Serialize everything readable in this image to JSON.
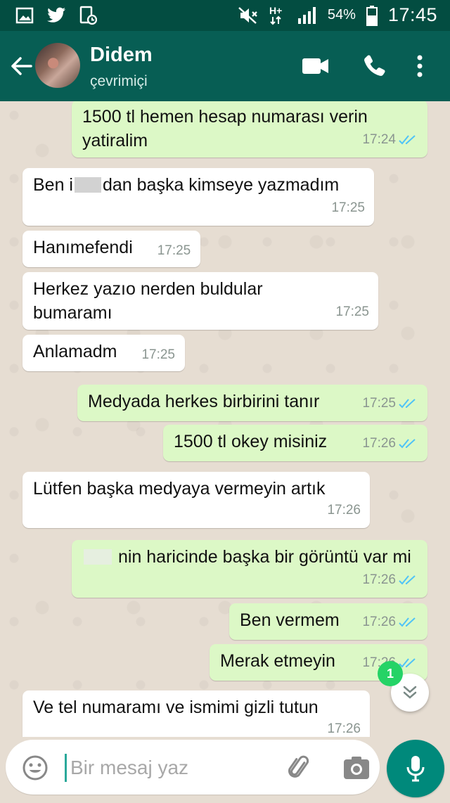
{
  "status_bar": {
    "battery": "54%",
    "clock": "17:45",
    "network": "H+",
    "left_icons": [
      "gallery-icon",
      "twitter-icon",
      "call-log-icon"
    ],
    "right_icons": [
      "mute-icon",
      "network-icon",
      "signal-icon",
      "battery-icon"
    ]
  },
  "header": {
    "contact_name": "Didem",
    "contact_status": "çevrimiçi",
    "icons": [
      "back-arrow-icon",
      "avatar",
      "video-call-icon",
      "phone-icon",
      "more-vert-icon"
    ]
  },
  "messages": [
    {
      "dir": "out",
      "text": "1500 tl hemen hesap numarası verin yatiralim",
      "time": "17:24",
      "read": true
    },
    {
      "dir": "in",
      "text_before": "Ben i",
      "text_after": "dan başka kimseye yazmadım",
      "time": "17:25"
    },
    {
      "dir": "in",
      "text": "Hanımefendi",
      "time": "17:25"
    },
    {
      "dir": "in",
      "text": "Herkez yazıo nerden buldular bumaramı",
      "time": "17:25"
    },
    {
      "dir": "in",
      "text": "Anlamadm",
      "time": "17:25"
    },
    {
      "dir": "out",
      "text": "Medyada herkes birbirini tanır",
      "time": "17:25",
      "read": true
    },
    {
      "dir": "out",
      "text": "1500 tl okey misiniz",
      "time": "17:26",
      "read": true
    },
    {
      "dir": "in",
      "text": "Lütfen başka medyaya vermeyin artık",
      "time": "17:26"
    },
    {
      "dir": "out",
      "text": "nin haricinde başka bir görüntü var mi",
      "time": "17:26",
      "read": true
    },
    {
      "dir": "out",
      "text": "Ben vermem",
      "time": "17:26",
      "read": true
    },
    {
      "dir": "out",
      "text": "Merak etmeyin",
      "time": "17:26",
      "read": true
    },
    {
      "dir": "in",
      "text": "Ve tel numaramı ve ismimi gizli tutun",
      "time": "17:26"
    }
  ],
  "scroll_fab": {
    "unread_count": "1"
  },
  "composer": {
    "placeholder": "Bir mesaj yaz",
    "value": "",
    "icons": [
      "emoji-icon",
      "attach-icon",
      "camera-icon",
      "mic-icon"
    ]
  },
  "colors": {
    "status_bar": "#034d41",
    "app_bar": "#075e54",
    "outgoing_bubble": "#dcf8c6",
    "incoming_bubble": "#ffffff",
    "read_ticks": "#4fc3f7",
    "mic_button": "#00897b",
    "unread_badge": "#25d366"
  }
}
